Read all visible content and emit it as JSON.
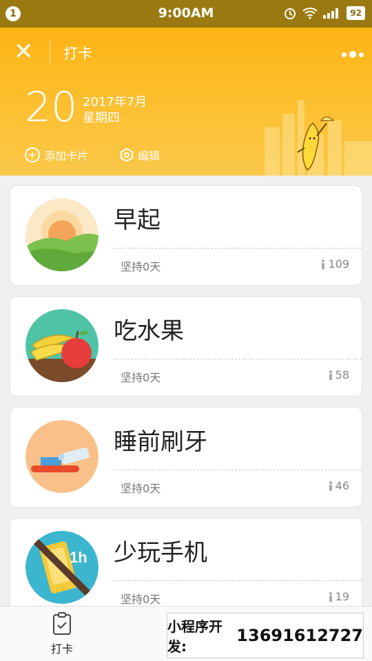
{
  "status": {
    "notification_count": "1",
    "time": "9:00AM",
    "battery": "92"
  },
  "header": {
    "title": "打卡",
    "day": "20",
    "year_month": "2017年7月",
    "weekday": "星期四",
    "add_card_label": "添加卡片",
    "edit_label": "编辑"
  },
  "cards": [
    {
      "name": "早起",
      "streak": "坚持0天",
      "count": "109"
    },
    {
      "name": "吃水果",
      "streak": "坚持0天",
      "count": "58"
    },
    {
      "name": "睡前刷牙",
      "streak": "坚持0天",
      "count": "46"
    },
    {
      "name": "少玩手机",
      "streak": "坚持0天",
      "count": "19",
      "badge": "1h"
    }
  ],
  "tabbar": {
    "tab_label": "打卡"
  },
  "promo": {
    "label": "小程序开发:",
    "phone": "13691612727"
  },
  "colors": {
    "header": "#fdb414",
    "statusbar": "#9a7a10"
  },
  "icons": [
    "close-icon",
    "more-icon",
    "add-icon",
    "hexagon-icon",
    "person-icon",
    "clipboard-check-icon"
  ]
}
